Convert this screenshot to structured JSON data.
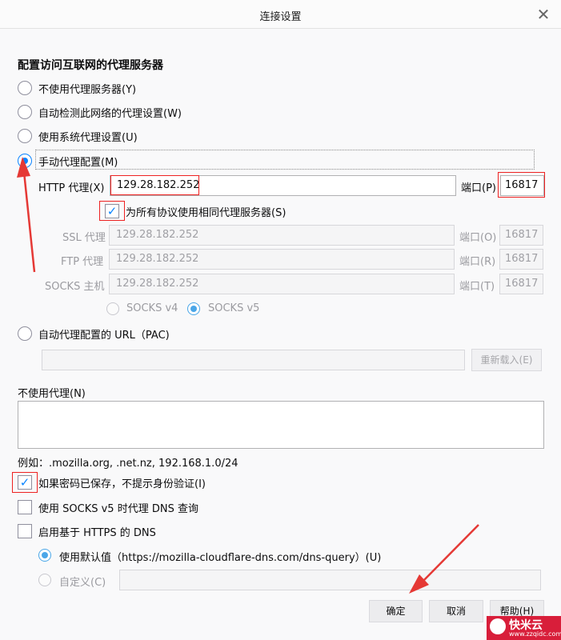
{
  "window": {
    "title": "连接设置",
    "close_glyph": "✕"
  },
  "section_title": "配置访问互联网的代理服务器",
  "proxy_options": {
    "no_proxy": "不使用代理服务器(Y)",
    "auto_detect": "自动检测此网络的代理设置(W)",
    "system": "使用系统代理设置(U)",
    "manual": "手动代理配置(M)"
  },
  "http": {
    "label": "HTTP 代理(X)",
    "value": "129.28.182.252",
    "port_label": "端口(P)",
    "port": "16817"
  },
  "share_all": {
    "label": "为所有协议使用相同代理服务器(S)",
    "checked": true
  },
  "ssl": {
    "label": "SSL 代理",
    "value": "129.28.182.252",
    "port_label": "端口(O)",
    "port": "16817"
  },
  "ftp": {
    "label": "FTP 代理",
    "value": "129.28.182.252",
    "port_label": "端口(R)",
    "port": "16817"
  },
  "socks": {
    "label": "SOCKS 主机",
    "value": "129.28.182.252",
    "port_label": "端口(T)",
    "port": "16817"
  },
  "socks_version": {
    "v4": "SOCKS v4",
    "v5": "SOCKS v5",
    "selected": "v5"
  },
  "pac": {
    "label": "自动代理配置的 URL（PAC)",
    "value": "",
    "reload_label": "重新载入(E)"
  },
  "no_proxy_for": {
    "label": "不使用代理(N)",
    "value": "",
    "example": "例如：.mozilla.org, .net.nz, 192.168.1.0/24"
  },
  "checkboxes": {
    "no_auth_prompt": {
      "label": "如果密码已保存，不提示身份验证(I)",
      "checked": true
    },
    "socks_dns": {
      "label": "使用 SOCKS v5 时代理 DNS 查询",
      "checked": false
    },
    "https_dns": {
      "label": "启用基于 HTTPS 的 DNS",
      "checked": false
    }
  },
  "doh": {
    "default_label": "使用默认值（https://mozilla-cloudflare-dns.com/dns-query）(U)",
    "custom_label": "自定义(C)",
    "custom_value": ""
  },
  "buttons": {
    "ok": "确定",
    "cancel": "取消",
    "help": "帮助(H)"
  },
  "colors": {
    "accent": "#0a84ff",
    "annotation": "#e53935"
  },
  "watermark": {
    "brand": "快米云",
    "url": "www.zzqidc.com"
  }
}
